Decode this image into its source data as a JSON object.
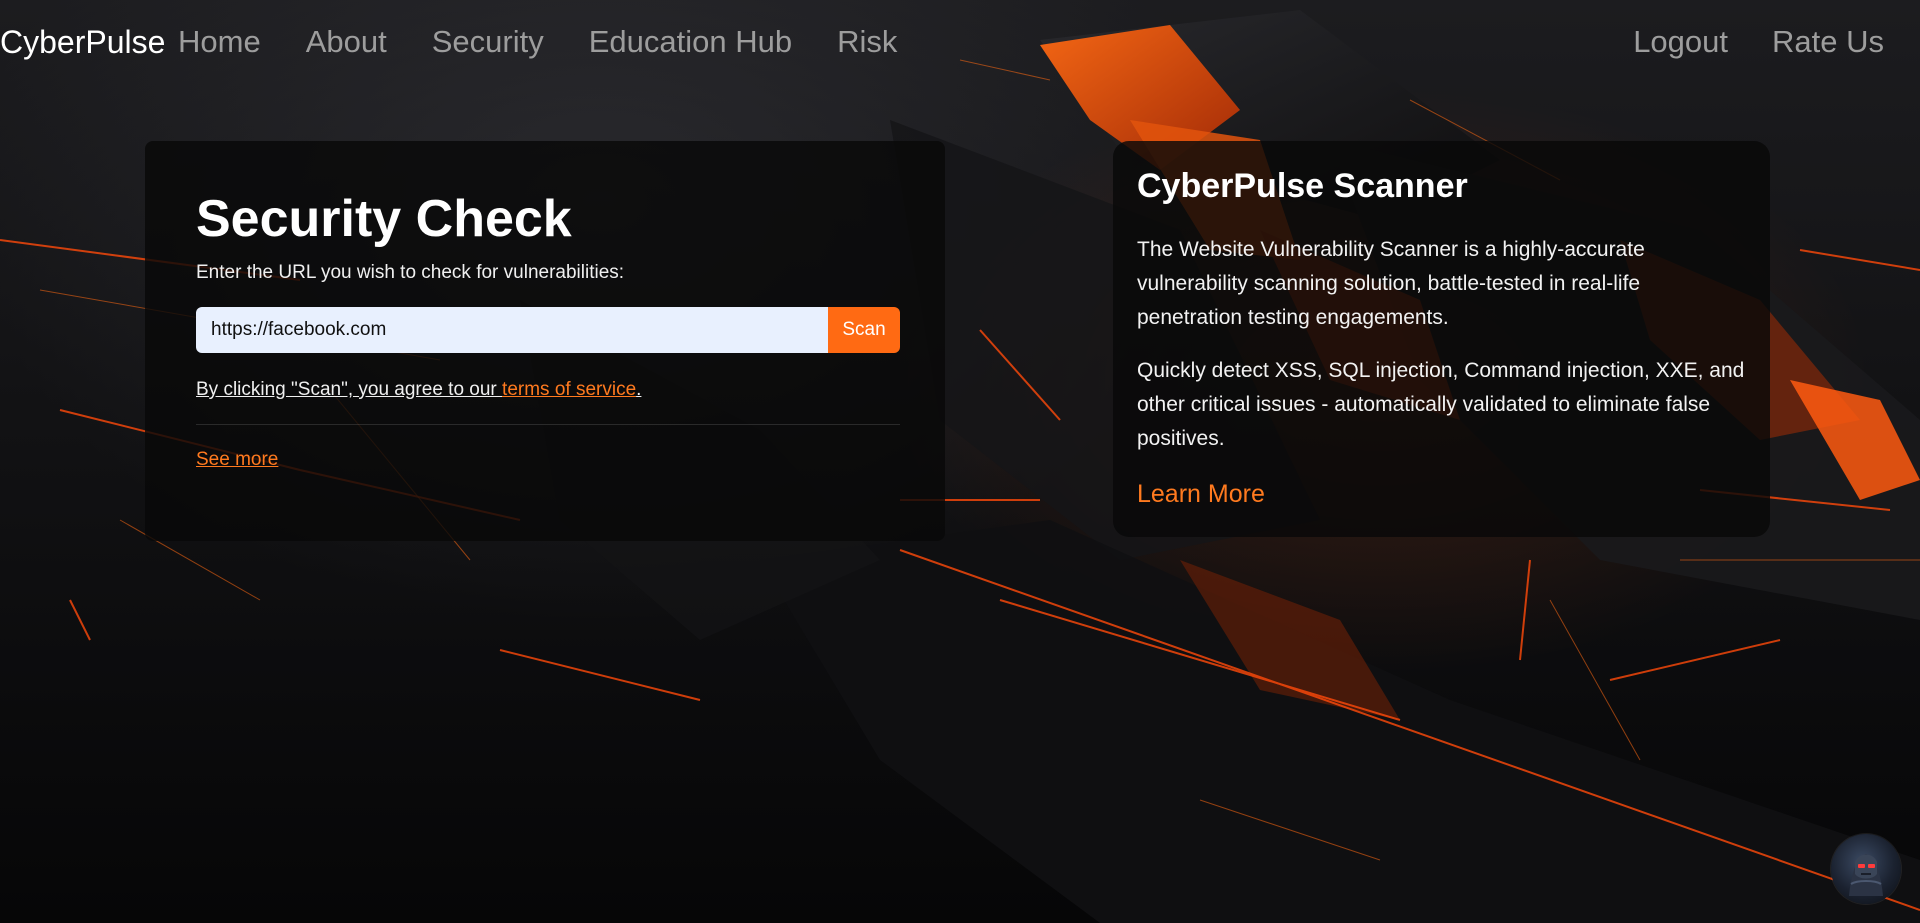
{
  "nav": {
    "brand": "CyberPulse",
    "left_links": [
      "Home",
      "About",
      "Security",
      "Education Hub",
      "Risk"
    ],
    "right_links": [
      "Logout",
      "Rate Us"
    ]
  },
  "security_check": {
    "title": "Security Check",
    "subtitle": "Enter the URL you wish to check for vulnerabilities:",
    "url_value": "https://facebook.com",
    "scan_label": "Scan",
    "terms_prefix": "By clicking \"Scan\", you agree to our ",
    "terms_link": "terms of service",
    "terms_suffix": ".",
    "see_more": "See more"
  },
  "scanner": {
    "title": "CyberPulse Scanner",
    "paragraph_1": "The Website Vulnerability Scanner is a highly-accurate vulnerability scanning solution, battle-tested in real-life penetration testing engagements.",
    "paragraph_2": "Quickly detect XSS, SQL injection, Command injection, XXE, and other critical issues - automatically validated to eliminate false positives.",
    "learn_more": "Learn More"
  },
  "colors": {
    "accent": "#ff6a13",
    "link": "#ff7a1f",
    "input_bg": "#e8f0fe"
  },
  "icons": {
    "chat_avatar": "robot-avatar-icon"
  }
}
